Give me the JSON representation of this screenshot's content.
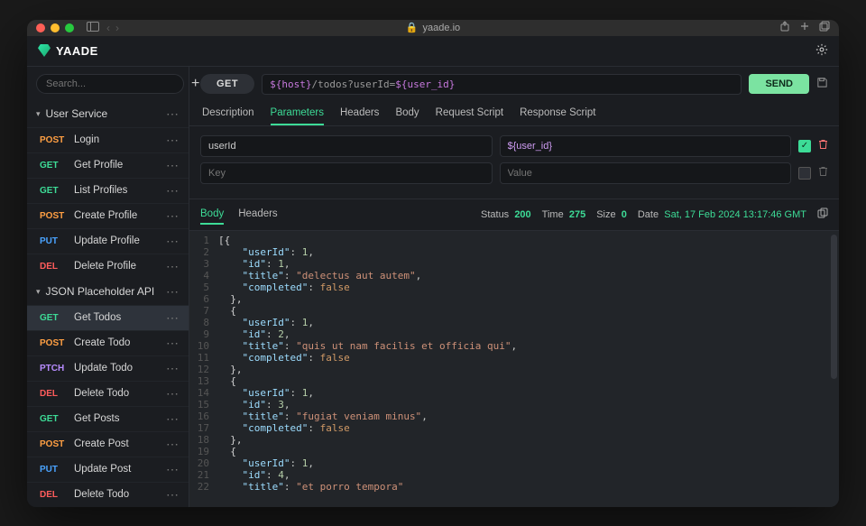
{
  "browser": {
    "domain": "yaade.io",
    "lock": "🔒"
  },
  "app": {
    "name": "YAADE"
  },
  "sidebar": {
    "search_placeholder": "Search...",
    "groups": [
      {
        "name": "User Service",
        "items": [
          {
            "method": "POST",
            "label": "Login"
          },
          {
            "method": "GET",
            "label": "Get Profile"
          },
          {
            "method": "GET",
            "label": "List Profiles"
          },
          {
            "method": "POST",
            "label": "Create Profile"
          },
          {
            "method": "PUT",
            "label": "Update Profile"
          },
          {
            "method": "DEL",
            "label": "Delete Profile"
          }
        ]
      },
      {
        "name": "JSON Placeholder API",
        "items": [
          {
            "method": "GET",
            "label": "Get Todos",
            "active": true
          },
          {
            "method": "POST",
            "label": "Create Todo"
          },
          {
            "method": "PTCH",
            "label": "Update Todo"
          },
          {
            "method": "DEL",
            "label": "Delete Todo"
          },
          {
            "method": "GET",
            "label": "Get Posts"
          },
          {
            "method": "POST",
            "label": "Create Post"
          },
          {
            "method": "PUT",
            "label": "Update Post"
          },
          {
            "method": "DEL",
            "label": "Delete Todo"
          }
        ]
      }
    ]
  },
  "request": {
    "method": "GET",
    "url_parts": {
      "host_var": "${host}",
      "path1": "/todos?userId=",
      "user_var": "${user_id}"
    },
    "send_label": "SEND",
    "tabs": [
      "Description",
      "Parameters",
      "Headers",
      "Body",
      "Request Script",
      "Response Script"
    ],
    "active_tab": "Parameters",
    "params": [
      {
        "key": "userId",
        "value": "${user_id}",
        "enabled": true
      },
      {
        "key": "",
        "value": "",
        "enabled": false,
        "key_placeholder": "Key",
        "value_placeholder": "Value"
      }
    ]
  },
  "response": {
    "tabs": [
      "Body",
      "Headers"
    ],
    "active_tab": "Body",
    "status_label": "Status",
    "status": "200",
    "time_label": "Time",
    "time": "275",
    "size_label": "Size",
    "size": "0",
    "date_label": "Date",
    "date": "Sat, 17 Feb 2024 13:17:46 GMT",
    "body": [
      {
        "userId": 1,
        "id": 1,
        "title": "delectus aut autem",
        "completed": false
      },
      {
        "userId": 1,
        "id": 2,
        "title": "quis ut nam facilis et officia qui",
        "completed": false
      },
      {
        "userId": 1,
        "id": 3,
        "title": "fugiat veniam minus",
        "completed": false
      },
      {
        "userId": 1,
        "id": 4,
        "title": "et porro tempora"
      }
    ]
  }
}
